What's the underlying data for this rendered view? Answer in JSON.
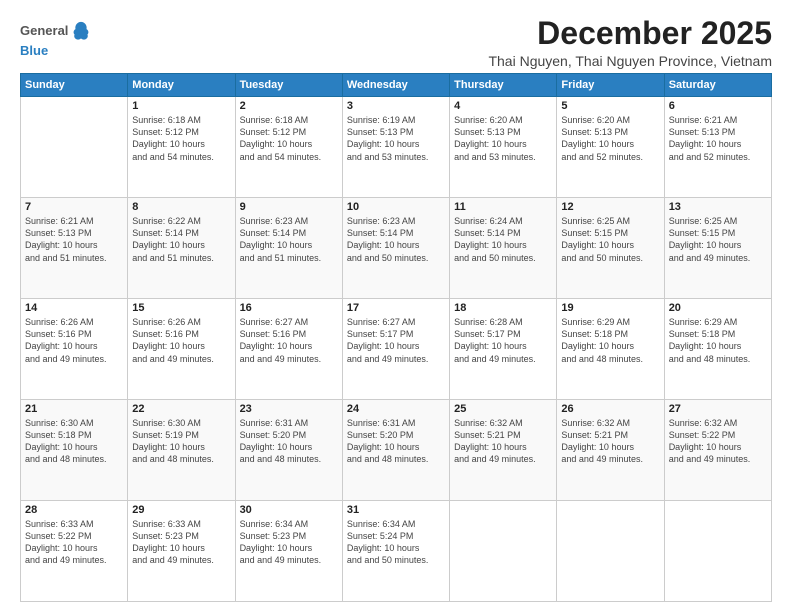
{
  "logo": {
    "line1": "General",
    "line2": "Blue"
  },
  "title": "December 2025",
  "subtitle": "Thai Nguyen, Thai Nguyen Province, Vietnam",
  "days": [
    "Sunday",
    "Monday",
    "Tuesday",
    "Wednesday",
    "Thursday",
    "Friday",
    "Saturday"
  ],
  "weeks": [
    [
      {
        "day": "",
        "sunrise": "",
        "sunset": "",
        "daylight": ""
      },
      {
        "day": "1",
        "sunrise": "Sunrise: 6:18 AM",
        "sunset": "Sunset: 5:12 PM",
        "daylight": "Daylight: 10 hours and 54 minutes."
      },
      {
        "day": "2",
        "sunrise": "Sunrise: 6:18 AM",
        "sunset": "Sunset: 5:12 PM",
        "daylight": "Daylight: 10 hours and 54 minutes."
      },
      {
        "day": "3",
        "sunrise": "Sunrise: 6:19 AM",
        "sunset": "Sunset: 5:13 PM",
        "daylight": "Daylight: 10 hours and 53 minutes."
      },
      {
        "day": "4",
        "sunrise": "Sunrise: 6:20 AM",
        "sunset": "Sunset: 5:13 PM",
        "daylight": "Daylight: 10 hours and 53 minutes."
      },
      {
        "day": "5",
        "sunrise": "Sunrise: 6:20 AM",
        "sunset": "Sunset: 5:13 PM",
        "daylight": "Daylight: 10 hours and 52 minutes."
      },
      {
        "day": "6",
        "sunrise": "Sunrise: 6:21 AM",
        "sunset": "Sunset: 5:13 PM",
        "daylight": "Daylight: 10 hours and 52 minutes."
      }
    ],
    [
      {
        "day": "7",
        "sunrise": "Sunrise: 6:21 AM",
        "sunset": "Sunset: 5:13 PM",
        "daylight": "Daylight: 10 hours and 51 minutes."
      },
      {
        "day": "8",
        "sunrise": "Sunrise: 6:22 AM",
        "sunset": "Sunset: 5:14 PM",
        "daylight": "Daylight: 10 hours and 51 minutes."
      },
      {
        "day": "9",
        "sunrise": "Sunrise: 6:23 AM",
        "sunset": "Sunset: 5:14 PM",
        "daylight": "Daylight: 10 hours and 51 minutes."
      },
      {
        "day": "10",
        "sunrise": "Sunrise: 6:23 AM",
        "sunset": "Sunset: 5:14 PM",
        "daylight": "Daylight: 10 hours and 50 minutes."
      },
      {
        "day": "11",
        "sunrise": "Sunrise: 6:24 AM",
        "sunset": "Sunset: 5:14 PM",
        "daylight": "Daylight: 10 hours and 50 minutes."
      },
      {
        "day": "12",
        "sunrise": "Sunrise: 6:25 AM",
        "sunset": "Sunset: 5:15 PM",
        "daylight": "Daylight: 10 hours and 50 minutes."
      },
      {
        "day": "13",
        "sunrise": "Sunrise: 6:25 AM",
        "sunset": "Sunset: 5:15 PM",
        "daylight": "Daylight: 10 hours and 49 minutes."
      }
    ],
    [
      {
        "day": "14",
        "sunrise": "Sunrise: 6:26 AM",
        "sunset": "Sunset: 5:16 PM",
        "daylight": "Daylight: 10 hours and 49 minutes."
      },
      {
        "day": "15",
        "sunrise": "Sunrise: 6:26 AM",
        "sunset": "Sunset: 5:16 PM",
        "daylight": "Daylight: 10 hours and 49 minutes."
      },
      {
        "day": "16",
        "sunrise": "Sunrise: 6:27 AM",
        "sunset": "Sunset: 5:16 PM",
        "daylight": "Daylight: 10 hours and 49 minutes."
      },
      {
        "day": "17",
        "sunrise": "Sunrise: 6:27 AM",
        "sunset": "Sunset: 5:17 PM",
        "daylight": "Daylight: 10 hours and 49 minutes."
      },
      {
        "day": "18",
        "sunrise": "Sunrise: 6:28 AM",
        "sunset": "Sunset: 5:17 PM",
        "daylight": "Daylight: 10 hours and 49 minutes."
      },
      {
        "day": "19",
        "sunrise": "Sunrise: 6:29 AM",
        "sunset": "Sunset: 5:18 PM",
        "daylight": "Daylight: 10 hours and 48 minutes."
      },
      {
        "day": "20",
        "sunrise": "Sunrise: 6:29 AM",
        "sunset": "Sunset: 5:18 PM",
        "daylight": "Daylight: 10 hours and 48 minutes."
      }
    ],
    [
      {
        "day": "21",
        "sunrise": "Sunrise: 6:30 AM",
        "sunset": "Sunset: 5:18 PM",
        "daylight": "Daylight: 10 hours and 48 minutes."
      },
      {
        "day": "22",
        "sunrise": "Sunrise: 6:30 AM",
        "sunset": "Sunset: 5:19 PM",
        "daylight": "Daylight: 10 hours and 48 minutes."
      },
      {
        "day": "23",
        "sunrise": "Sunrise: 6:31 AM",
        "sunset": "Sunset: 5:20 PM",
        "daylight": "Daylight: 10 hours and 48 minutes."
      },
      {
        "day": "24",
        "sunrise": "Sunrise: 6:31 AM",
        "sunset": "Sunset: 5:20 PM",
        "daylight": "Daylight: 10 hours and 48 minutes."
      },
      {
        "day": "25",
        "sunrise": "Sunrise: 6:32 AM",
        "sunset": "Sunset: 5:21 PM",
        "daylight": "Daylight: 10 hours and 49 minutes."
      },
      {
        "day": "26",
        "sunrise": "Sunrise: 6:32 AM",
        "sunset": "Sunset: 5:21 PM",
        "daylight": "Daylight: 10 hours and 49 minutes."
      },
      {
        "day": "27",
        "sunrise": "Sunrise: 6:32 AM",
        "sunset": "Sunset: 5:22 PM",
        "daylight": "Daylight: 10 hours and 49 minutes."
      }
    ],
    [
      {
        "day": "28",
        "sunrise": "Sunrise: 6:33 AM",
        "sunset": "Sunset: 5:22 PM",
        "daylight": "Daylight: 10 hours and 49 minutes."
      },
      {
        "day": "29",
        "sunrise": "Sunrise: 6:33 AM",
        "sunset": "Sunset: 5:23 PM",
        "daylight": "Daylight: 10 hours and 49 minutes."
      },
      {
        "day": "30",
        "sunrise": "Sunrise: 6:34 AM",
        "sunset": "Sunset: 5:23 PM",
        "daylight": "Daylight: 10 hours and 49 minutes."
      },
      {
        "day": "31",
        "sunrise": "Sunrise: 6:34 AM",
        "sunset": "Sunset: 5:24 PM",
        "daylight": "Daylight: 10 hours and 50 minutes."
      },
      {
        "day": "",
        "sunrise": "",
        "sunset": "",
        "daylight": ""
      },
      {
        "day": "",
        "sunrise": "",
        "sunset": "",
        "daylight": ""
      },
      {
        "day": "",
        "sunrise": "",
        "sunset": "",
        "daylight": ""
      }
    ]
  ]
}
